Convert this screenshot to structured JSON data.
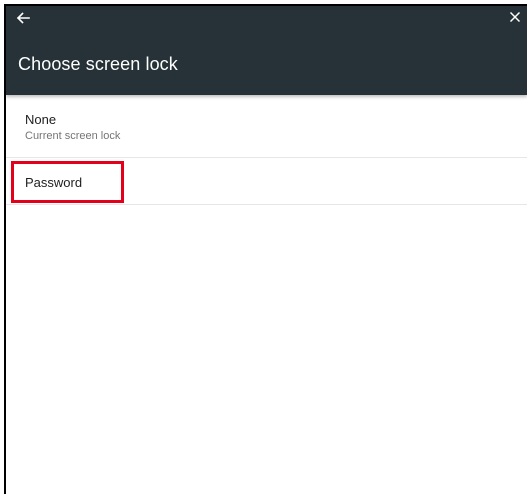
{
  "header": {
    "back_icon": "arrow-left-icon",
    "close_icon": "close-icon",
    "title": "Choose screen lock",
    "background_color": "#263238"
  },
  "options": [
    {
      "title": "None",
      "subtitle": "Current screen lock"
    },
    {
      "title": "Password",
      "highlighted": true
    }
  ],
  "highlight_color": "#e3001b"
}
